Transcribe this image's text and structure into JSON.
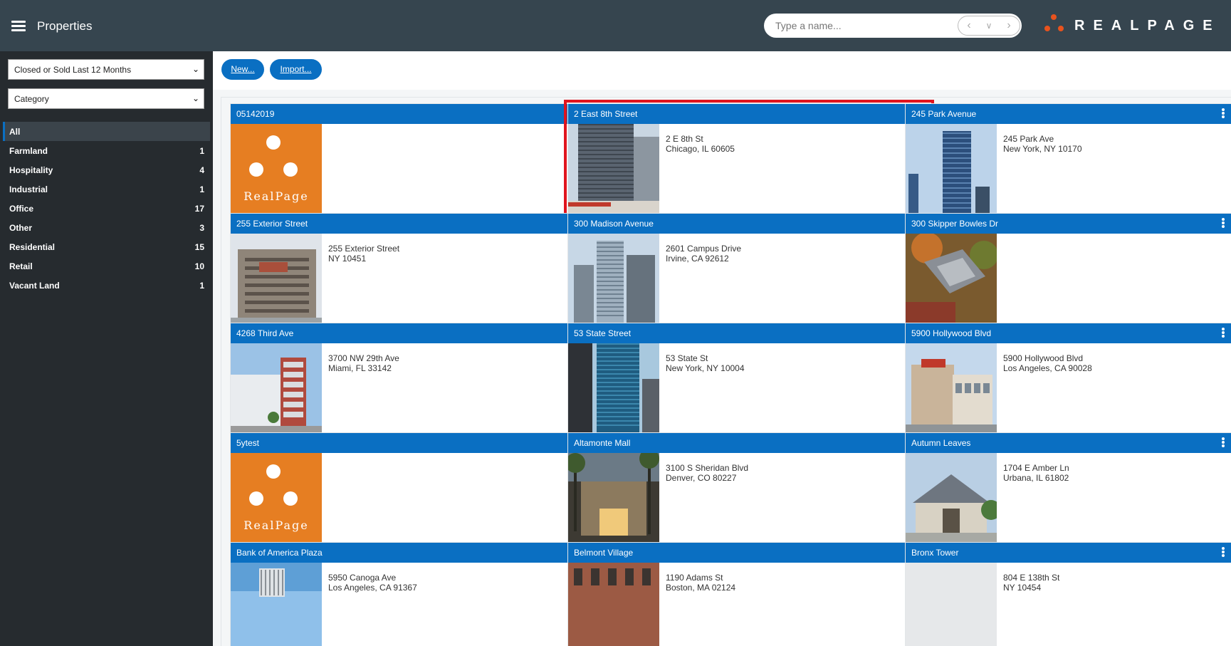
{
  "header": {
    "title": "Properties",
    "search_placeholder": "Type a name...",
    "brand": "REALPAGE"
  },
  "sidebar": {
    "filter_select": "Closed or Sold Last 12 Months",
    "category_select": "Category",
    "categories": [
      {
        "label": "All",
        "count": ""
      },
      {
        "label": "Farmland",
        "count": "1"
      },
      {
        "label": "Hospitality",
        "count": "4"
      },
      {
        "label": "Industrial",
        "count": "1"
      },
      {
        "label": "Office",
        "count": "17"
      },
      {
        "label": "Other",
        "count": "3"
      },
      {
        "label": "Residential",
        "count": "15"
      },
      {
        "label": "Retail",
        "count": "10"
      },
      {
        "label": "Vacant Land",
        "count": "1"
      }
    ]
  },
  "toolbar": {
    "new_label": "New...",
    "import_label": "Import..."
  },
  "thumb_brand": "RealPage",
  "colors": {
    "topbar": "#36454f",
    "sidebar": "#262b2f",
    "accent": "#0a6fc2",
    "selected_outline": "#e0141e",
    "brand_orange": "#e67e22"
  },
  "properties": [
    {
      "name": "05142019",
      "line1": "",
      "line2": "",
      "thumb": "realpage-logo"
    },
    {
      "name": "2 East 8th Street",
      "line1": "2 E 8th St",
      "line2": "Chicago, IL  60605",
      "thumb": "photo-highrise",
      "selected": true
    },
    {
      "name": "245 Park Avenue",
      "line1": "245 Park Ave",
      "line2": "New York, NY  10170",
      "thumb": "photo-glass-tower"
    },
    {
      "name": "255 Exterior Street",
      "line1": "255 Exterior Street",
      "line2": "NY  10451",
      "thumb": "photo-parking-garage"
    },
    {
      "name": "300 Madison Avenue",
      "line1": "2601 Campus Drive",
      "line2": "Irvine, CA  92612",
      "thumb": "photo-skyline"
    },
    {
      "name": "300 Skipper Bowles Dr",
      "line1": "",
      "line2": "",
      "thumb": "photo-aerial-campus"
    },
    {
      "name": "4268 Third Ave",
      "line1": "3700 NW 29th Ave",
      "line2": "Miami, FL  33142",
      "thumb": "photo-warehouse"
    },
    {
      "name": "53 State Street",
      "line1": "53 State St",
      "line2": "New York, NY  10004",
      "thumb": "photo-blue-tower"
    },
    {
      "name": "5900 Hollywood Blvd",
      "line1": "5900 Hollywood Blvd",
      "line2": "Los Angeles, CA  90028",
      "thumb": "photo-retail-building"
    },
    {
      "name": "5ytest",
      "line1": "",
      "line2": "",
      "thumb": "realpage-logo"
    },
    {
      "name": "Altamonte Mall",
      "line1": "3100 S Sheridan Blvd",
      "line2": "Denver, CO  80227",
      "thumb": "photo-palms-entrance"
    },
    {
      "name": "Autumn Leaves",
      "line1": "1704 E Amber Ln",
      "line2": "Urbana, IL  61802",
      "thumb": "photo-senior-living"
    },
    {
      "name": "Bank of America Plaza",
      "line1": "5950 Canoga Ave",
      "line2": "Los Angeles, CA  91367",
      "thumb": "photo-office-sky"
    },
    {
      "name": "Belmont Village",
      "line1": "1190 Adams St",
      "line2": "Boston, MA  02124",
      "thumb": "photo-brick"
    },
    {
      "name": "Bronx Tower",
      "line1": "804 E 138th St",
      "line2": "NY  10454",
      "thumb": "none"
    }
  ]
}
